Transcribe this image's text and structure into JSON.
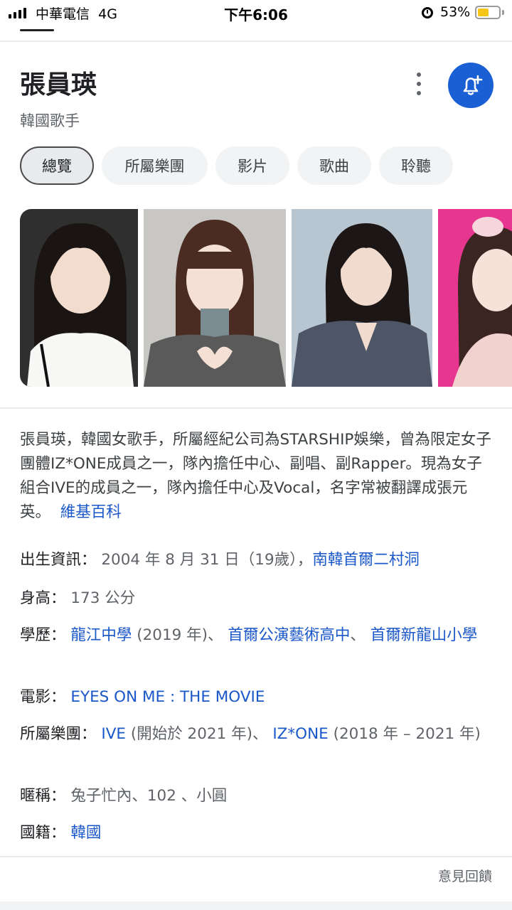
{
  "status_bar": {
    "carrier": "中華電信",
    "network": "4G",
    "time": "下午6:06",
    "battery_pct": "53%",
    "battery_level": 0.53
  },
  "header": {
    "title": "張員瑛",
    "subtitle": "韓國歌手"
  },
  "tabs": [
    {
      "label": "總覽",
      "active": true
    },
    {
      "label": "所屬樂團",
      "active": false
    },
    {
      "label": "影片",
      "active": false
    },
    {
      "label": "歌曲",
      "active": false
    },
    {
      "label": "聆聽",
      "active": false
    }
  ],
  "description": {
    "text": "張員瑛，韓國女歌手，所屬經紀公司為STARSHIP娛樂，曾為限定女子團體IZ*ONE成員之一，隊內擔任中心、副唱、副Rapper。現為女子組合IVE的成員之一，隊內擔任中心及Vocal，名字常被翻譯成張元英。",
    "source": "維基百科"
  },
  "facts": {
    "birth": {
      "label": "出生資訊：",
      "value": "2004 年 8 月 31 日（19歲）",
      "sep": "，",
      "link": "南韓首爾二村洞"
    },
    "height": {
      "label": "身高：",
      "value": "173 公分"
    },
    "education": {
      "label": "學歷：",
      "link1": "龍江中學",
      "text1": " (2019 年)、",
      "link2": "首爾公演藝術高中",
      "text2": "、",
      "link3": "首爾新龍山小學"
    },
    "film": {
      "label": "電影：",
      "link": "EYES ON ME : THE MOVIE"
    },
    "groups": {
      "label": "所屬樂團：",
      "link1": "IVE",
      "text1": " (開始於 2021 年)、",
      "link2": "IZ*ONE",
      "text2": " (2018 年 – 2021 年)"
    },
    "nickname": {
      "label": "暱稱：",
      "value": "兔子忙內、102 、小圓"
    },
    "nationality": {
      "label": "國籍：",
      "link": "韓國"
    }
  },
  "feedback": "意見回饋",
  "colors": {
    "accent": "#1a5fd4",
    "link": "#1a57c9"
  },
  "icons": [
    "signal-icon",
    "alarm-icon",
    "battery-icon",
    "more-vert-icon",
    "bell-add-icon"
  ]
}
